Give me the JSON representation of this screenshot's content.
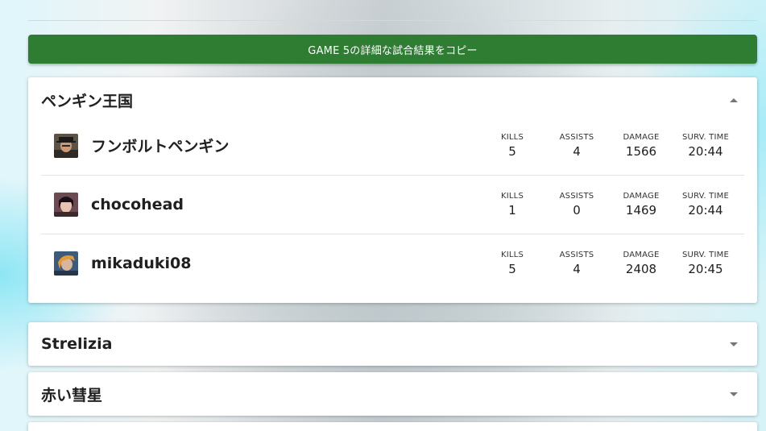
{
  "copy_button": {
    "label": "GAME 5の詳細な試合結果をコピー"
  },
  "stat_labels": {
    "kills": "KILLS",
    "assists": "ASSISTS",
    "damage": "DAMAGE",
    "surv_time": "SURV. TIME"
  },
  "teams": [
    {
      "name": "ペンギン王国",
      "expanded": true,
      "players": [
        {
          "name": "フンボルトペンギン",
          "kills": "5",
          "assists": "4",
          "damage": "1566",
          "surv_time": "20:44"
        },
        {
          "name": "chocohead",
          "kills": "1",
          "assists": "0",
          "damage": "1469",
          "surv_time": "20:44"
        },
        {
          "name": "mikaduki08",
          "kills": "5",
          "assists": "4",
          "damage": "2408",
          "surv_time": "20:45"
        }
      ]
    },
    {
      "name": "Strelizia",
      "expanded": false
    },
    {
      "name": "赤い彗星",
      "expanded": false
    }
  ],
  "colors": {
    "copy_button_bg": "#2e7d32",
    "panel_bg": "#ffffff"
  }
}
